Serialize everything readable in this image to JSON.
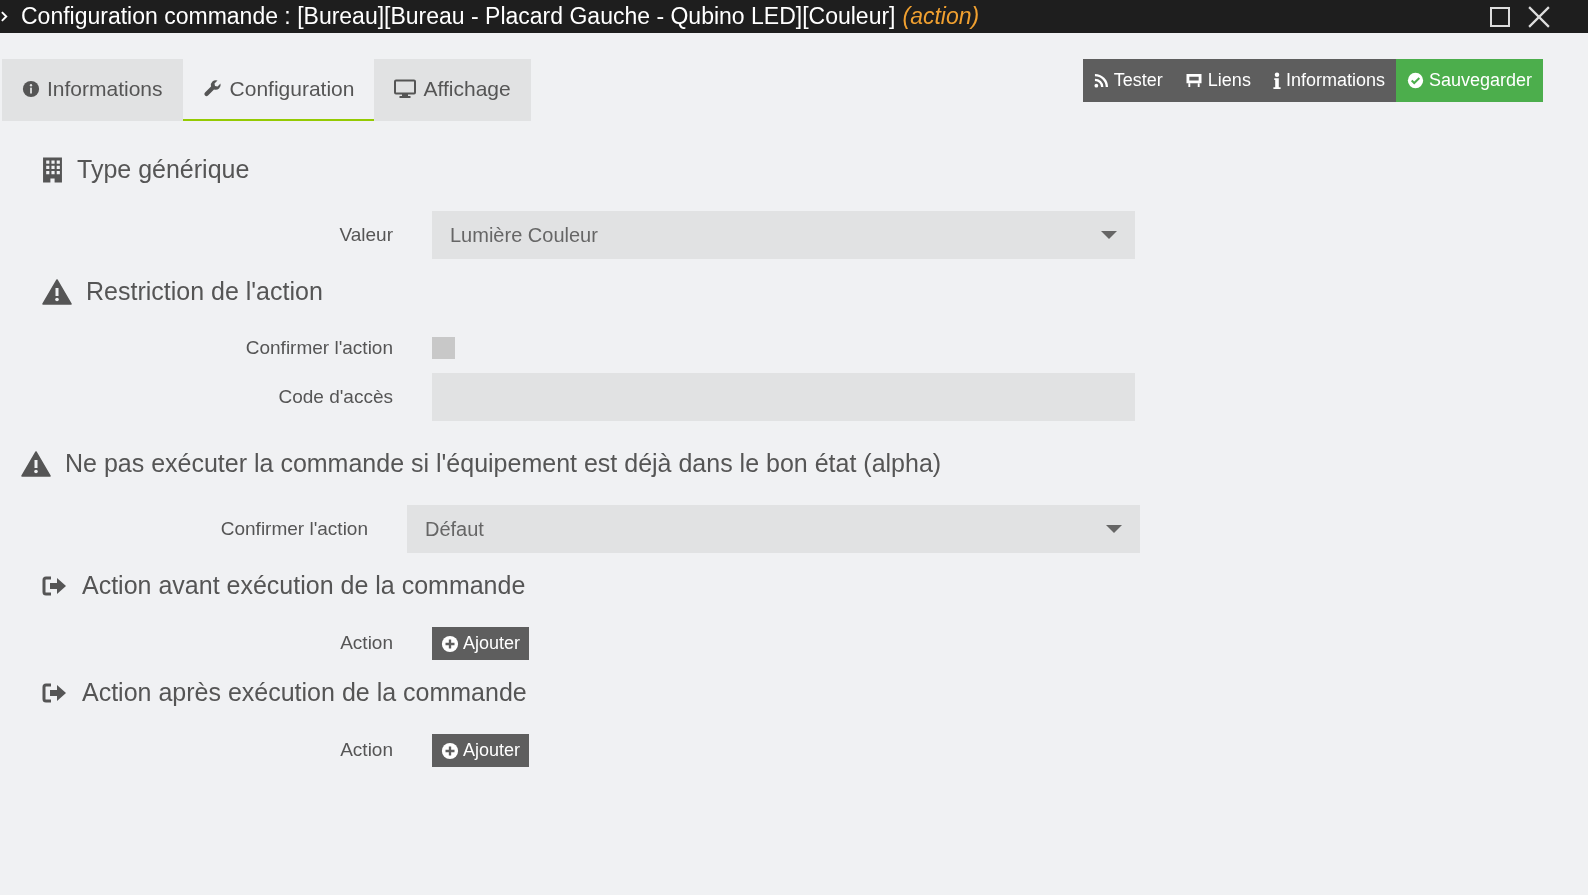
{
  "window": {
    "title": "Configuration commande : [Bureau][Bureau - Placard Gauche - Qubino LED][Couleur]",
    "subtitle": "(action)"
  },
  "tabs": [
    {
      "label": "Informations",
      "selected": false
    },
    {
      "label": "Configuration",
      "selected": true
    },
    {
      "label": "Affichage",
      "selected": false
    }
  ],
  "toolbar": [
    {
      "label": "Tester",
      "kind": "dark"
    },
    {
      "label": "Liens",
      "kind": "dark"
    },
    {
      "label": "Informations",
      "kind": "dark"
    },
    {
      "label": "Sauvegarder",
      "kind": "success"
    }
  ],
  "sections": [
    {
      "title": "Type générique",
      "fields": [
        {
          "kind": "select",
          "label": "Valeur",
          "value": "Lumière Couleur"
        }
      ]
    },
    {
      "title": "Restriction de l'action",
      "fields": [
        {
          "kind": "checkbox",
          "label": "Confirmer l'action",
          "checked": false
        },
        {
          "kind": "input",
          "label": "Code d'accès"
        }
      ]
    },
    {
      "title": "Ne pas exécuter la commande si l'équipement est déjà dans le bon état (alpha)",
      "fields": [
        {
          "kind": "select",
          "label": "Confirmer l'action",
          "value": "Défaut"
        }
      ]
    },
    {
      "title": "Action avant exécution de la commande",
      "fields": [
        {
          "kind": "button",
          "label": "Action",
          "button": "Ajouter"
        }
      ]
    },
    {
      "title": "Action après exécution de la commande",
      "fields": [
        {
          "kind": "button",
          "label": "Action",
          "button": "Ajouter"
        }
      ]
    }
  ]
}
